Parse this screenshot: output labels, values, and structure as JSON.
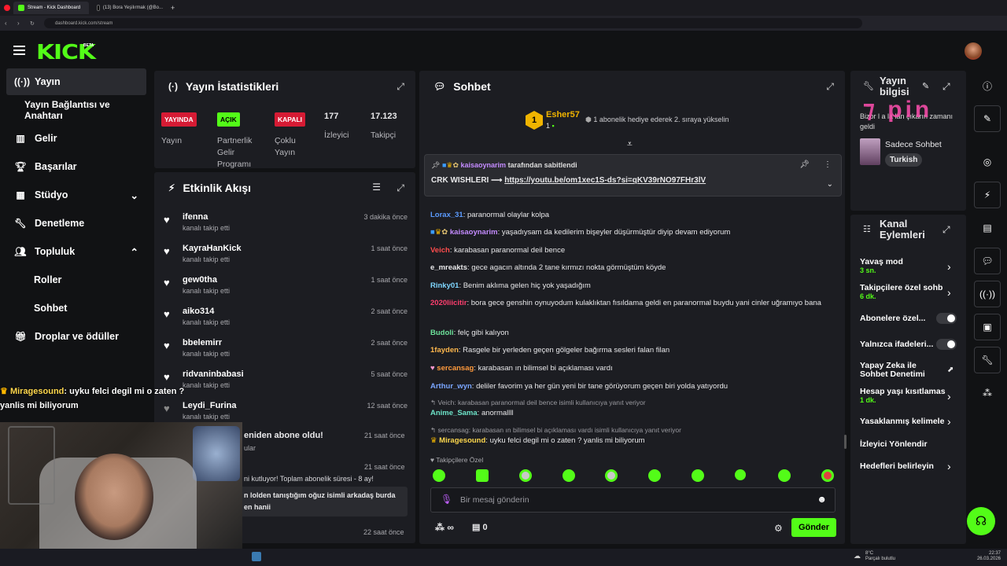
{
  "browser": {
    "tabs": [
      "Stream - Kick Dashboard",
      "(13) Bora Yeşilırmak (@Bo..."
    ],
    "url": "dashboard.kick.com/stream"
  },
  "header": {
    "logo": "KICK",
    "beta": "BETA"
  },
  "sidebar": {
    "items": [
      {
        "label": "Yayın",
        "icon": "broadcast-icon"
      },
      {
        "label": "Yayın Bağlantısı ve Anahtarı",
        "icon": ""
      },
      {
        "label": "Gelir",
        "icon": "chart-icon"
      },
      {
        "label": "Başarılar",
        "icon": "trophy-icon"
      },
      {
        "label": "Stüdyo",
        "icon": "studio-icon"
      },
      {
        "label": "Denetleme",
        "icon": "wrench-icon"
      },
      {
        "label": "Topluluk",
        "icon": "users-icon"
      },
      {
        "label": "Roller",
        "icon": ""
      },
      {
        "label": "Sohbet",
        "icon": ""
      },
      {
        "label": "Droplar ve ödüller",
        "icon": "gift-icon"
      }
    ]
  },
  "overlay": {
    "user": "Miragesound",
    "text": ": uyku felci degil mi o zaten ?",
    "text2": "yanlis mi biliyorum"
  },
  "stats": {
    "title": "Yayın İstatistikleri",
    "items": [
      {
        "badge": "YAYINDA",
        "label": "Yayın"
      },
      {
        "badge": "AÇIK",
        "label": "Partnerlik Gelir Programı"
      },
      {
        "badge": "KAPALI",
        "label": "Çoklu Yayın"
      },
      {
        "value": "177",
        "label": "İzleyici"
      },
      {
        "value": "17.123",
        "label": "Takipçi"
      }
    ]
  },
  "feed": {
    "title": "Etkinlik Akışı",
    "rows": [
      {
        "name": "ifenna",
        "sub": "kanalı takip etti",
        "time": "3 dakika önce"
      },
      {
        "name": "KayraHanKick",
        "sub": "kanalı takip etti",
        "time": "1 saat önce"
      },
      {
        "name": "gew0tha",
        "sub": "kanalı takip etti",
        "time": "1 saat önce"
      },
      {
        "name": "aiko314",
        "sub": "kanalı takip etti",
        "time": "2 saat önce"
      },
      {
        "name": "bbelemirr",
        "sub": "kanalı takip etti",
        "time": "2 saat önce"
      },
      {
        "name": "ridvaninbabasi",
        "sub": "kanalı takip etti",
        "time": "5 saat önce"
      },
      {
        "name": "Leydi_Furina",
        "sub": "kanalı takip etti",
        "time": "12 saat önce"
      }
    ],
    "partial": [
      {
        "text": "eniden abone oldu!",
        "time": "21 saat önce"
      },
      {
        "text": "ular",
        "time": ""
      },
      {
        "text": "",
        "time": "21 saat önce"
      },
      {
        "text": "ni kutluyor! Toplam abonelik süresi - 8 ay!",
        "time": ""
      },
      {
        "text": "n lolden tanıştığım oğuz isimli arkadaş burda",
        "time": ""
      },
      {
        "text": "en hanii",
        "time": ""
      },
      {
        "text": "",
        "time": "22 saat önce"
      }
    ]
  },
  "chat": {
    "title": "Sohbet",
    "gifter": {
      "rank": "1",
      "name": "Esher57",
      "count": "1",
      "promo": "1 abonelik hediye ederek 2. sıraya yükselin"
    },
    "pinned": {
      "by": "kaisaoynarim",
      "by_suffix": "tarafından sabitlendi",
      "text": "CRK WISHLERI ⟶",
      "link": "https://youtu.be/om1xec1S-ds?si=qKV39rNO97FHr3lV"
    },
    "messages": [
      {
        "user": "Lorax_31",
        "color": "#5b9bff",
        "text": ": paranormal olaylar kolpa"
      },
      {
        "user": "kaisaoynarim",
        "color": "#c48bff",
        "text": ": yaşadıysam da kedilerim bişeyler düşürmüştür diyip devam ediyorum"
      },
      {
        "user": "Veich",
        "color": "#ff4d4d",
        "text": ": karabasan paranormal deil bence"
      },
      {
        "user": "e_mreakts",
        "color": "#e8e8ea",
        "text": ": gece agacın altında 2 tane kırmızı nokta görmüştüm köyde"
      },
      {
        "user": "Rinky01",
        "color": "#7fd6ff",
        "text": ": Benim aklıma gelen hiç yok yaşadığım"
      },
      {
        "user": "2020liicitir",
        "color": "#ff3e6e",
        "text": ": bora gece genshin oynuyodum kulaklıktan fısıldama geldi en paranormal buydu yani cinler uğramıyo bana"
      },
      {
        "user": "Budoli",
        "color": "#6de39b",
        "text": ": felç gibi kalıyon"
      },
      {
        "user": "1fayden",
        "color": "#ffb84d",
        "text": ": Rasgele bir yerleden geçen gölgeler bağırma sesleri falan filan"
      },
      {
        "user": "sercansag",
        "color": "#ff9a3c",
        "text": ": karabasan ın bilimsel bi açıklaması vardı"
      },
      {
        "user": "Arthur_wyn",
        "color": "#7aa6ff",
        "text": ": deliler favorim ya her gün yeni bir tane görüyorum geçen biri yolda yatıyordu"
      }
    ],
    "reply1": {
      "ref": "Veich: karabasan paranormal deil bence isimli kullanıcıya yanıt veriyor",
      "user": "Anime_Sama",
      "text": ": anormallll"
    },
    "reply2": {
      "ref": "sercansag: karabasan ın bilimsel bi açıklaması vardı isimli kullanıcıya yanıt veriyor",
      "user": "Miragesound",
      "text": ": uyku felci degil mi o zaten ? yanlis mi biliyorum"
    },
    "followers_only": "Takipçilere Özel",
    "placeholder": "Bir mesaj gönderin",
    "infinity": "∞",
    "count": "0",
    "send": "Gönder"
  },
  "stream_info": {
    "title": "Yayın bilgisi",
    "overlay": "Bizor l a la lan çıkarın zamanı geldi",
    "category": "Sadece Sohbet",
    "tag": "Turkish"
  },
  "channel_actions": {
    "title": "Kanal Eylemleri",
    "items": [
      {
        "label": "Yavaş mod",
        "sub": "3 sn."
      },
      {
        "label": "Takipçilere özel sohb",
        "sub": "6 dk."
      },
      {
        "label": "Abonelere özel...",
        "sub": ""
      },
      {
        "label": "Yalnızca ifadeleri...",
        "sub": ""
      },
      {
        "label": "Yapay Zeka ile Sohbet Denetimi",
        "sub": ""
      },
      {
        "label": "Hesap yaşı kısıtlamas",
        "sub": "1 dk."
      },
      {
        "label": "Yasaklanmış kelimele",
        "sub": ""
      },
      {
        "label": "İzleyici Yönlendir",
        "sub": ""
      },
      {
        "label": "Hedefleri belirleyin",
        "sub": ""
      }
    ]
  },
  "taskbar": {
    "weather": "8°C",
    "weather_desc": "Parçalı bulutlu",
    "time": "22:37",
    "date": "26.03.2026"
  },
  "colors": {
    "accent": "#53fc18",
    "live": "#d61b34",
    "bg": "#111214",
    "panel": "#1c1d22"
  }
}
